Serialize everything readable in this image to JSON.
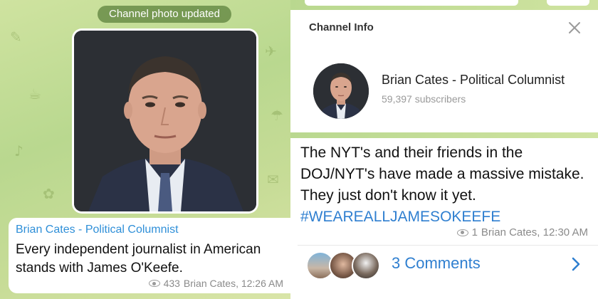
{
  "left_panel": {
    "service_message": "Channel photo updated",
    "message": {
      "author": "Brian Cates - Political Columnist",
      "text": "Every independent journalist in American stands with James O'Keefe.",
      "views": "433",
      "signature": "Brian Cates, 12:26 AM"
    }
  },
  "right_panel": {
    "channel_info": {
      "title": "Channel Info",
      "channel_name": "Brian Cates - Political Columnist",
      "subscribers": "59,397 subscribers"
    },
    "message": {
      "text": "The NYT's and their friends in the DOJ/NYT's have made a massive mistake.  They just don't know it yet.",
      "hashtag": "#WEAREALLJAMESOKEEFE",
      "views": "1",
      "signature": "Brian Cates, 12:30 AM"
    },
    "comments": {
      "label": "3 Comments"
    }
  },
  "icons": {
    "eye": "eye-icon",
    "close": "close-icon",
    "chevron": "chevron-right-icon"
  },
  "colors": {
    "accent_blue": "#2f7fd0",
    "chat_background": "#c4dc97",
    "meta_gray": "#8a8a8a"
  }
}
